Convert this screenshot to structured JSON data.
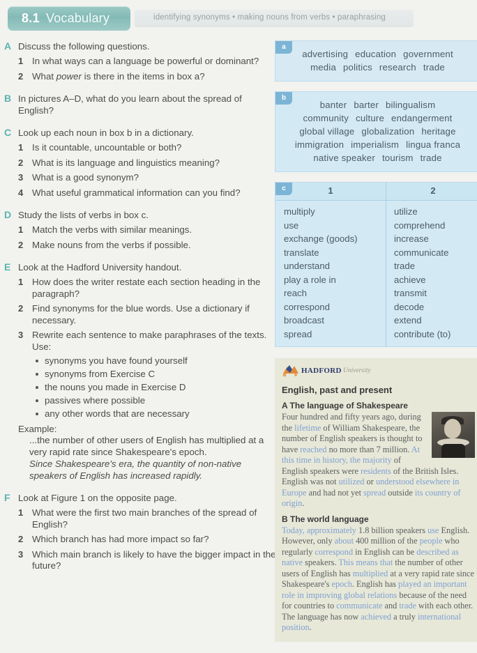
{
  "header": {
    "unit_number": "8.1",
    "unit_title": "Vocabulary",
    "skills": "identifying synonyms • making nouns from verbs • paraphrasing"
  },
  "exercises": [
    {
      "letter": "A",
      "heading": "Discuss the following questions.",
      "items": [
        {
          "num": "1",
          "text": "In what ways can a language be powerful or dominant?"
        },
        {
          "num": "2",
          "text": "What power is there in the items in box a?",
          "italic_word": "power"
        }
      ]
    },
    {
      "letter": "B",
      "heading": "In pictures A–D, what do you learn about the spread of English?",
      "items": []
    },
    {
      "letter": "C",
      "heading": "Look up each noun in box b in a dictionary.",
      "items": [
        {
          "num": "1",
          "text": "Is it countable, uncountable or both?"
        },
        {
          "num": "2",
          "text": "What is its language and linguistics meaning?"
        },
        {
          "num": "3",
          "text": "What is a good synonym?"
        },
        {
          "num": "4",
          "text": "What useful grammatical information can you find?"
        }
      ]
    },
    {
      "letter": "D",
      "heading": "Study the lists of verbs in box c.",
      "items": [
        {
          "num": "1",
          "text": "Match the verbs with similar meanings."
        },
        {
          "num": "2",
          "text": "Make nouns from the verbs if possible."
        }
      ]
    },
    {
      "letter": "E",
      "heading": "Look at the Hadford University handout.",
      "items": [
        {
          "num": "1",
          "text": "How does the writer restate each section heading in the paragraph?"
        },
        {
          "num": "2",
          "text": "Find synonyms for the blue words. Use a dictionary if necessary."
        },
        {
          "num": "3",
          "text": "Rewrite each sentence to make paraphrases of the texts. Use:"
        }
      ],
      "bullets": [
        "synonyms you have found yourself",
        "synonyms from Exercise C",
        "the nouns you made in Exercise D",
        "passives where possible",
        "any other words that are necessary"
      ],
      "example_label": "Example:",
      "example_plain": "...the number of other users of English has multiplied at a very rapid rate since Shakespeare's epoch.",
      "example_italic": "Since Shakespeare's era, the quantity of non-native speakers of English has increased rapidly."
    },
    {
      "letter": "F",
      "heading": "Look at Figure 1 on the opposite page.",
      "items": [
        {
          "num": "1",
          "text": "What were the first two main branches of the spread of English?"
        },
        {
          "num": "2",
          "text": "Which branch has had more impact so far?"
        },
        {
          "num": "3",
          "text": "Which main branch is likely to have the bigger impact in the future?"
        }
      ]
    }
  ],
  "box_a": {
    "label": "a",
    "lines": [
      [
        "advertising",
        "education",
        "government"
      ],
      [
        "media",
        "politics",
        "research",
        "trade"
      ]
    ]
  },
  "box_b": {
    "label": "b",
    "lines": [
      [
        "banter",
        "barter",
        "bilingualism"
      ],
      [
        "community",
        "culture",
        "endangerment"
      ],
      [
        "global village",
        "globalization",
        "heritage"
      ],
      [
        "immigration",
        "imperialism",
        "lingua franca"
      ],
      [
        "native speaker",
        "tourism",
        "trade"
      ]
    ]
  },
  "box_c": {
    "label": "c",
    "columns": [
      "1",
      "2"
    ],
    "column1": [
      "multiply",
      "use",
      "exchange (goods)",
      "translate",
      "understand",
      "play a role in",
      "reach",
      "correspond",
      "broadcast",
      "spread"
    ],
    "column2": [
      "utilize",
      "comprehend",
      "increase",
      "communicate",
      "trade",
      "achieve",
      "transmit",
      "decode",
      "extend",
      "contribute (to)"
    ]
  },
  "handout": {
    "logo_name": "HADFORD",
    "logo_sub": "University",
    "title": "English, past and present",
    "section_a": {
      "heading": "A The language of Shakespeare",
      "parts": [
        {
          "t": "Four hundred and fifty years ago, during the ",
          "hl": false
        },
        {
          "t": "lifetime",
          "hl": true
        },
        {
          "t": " of William Shakespeare, the number of English speakers is thought to have ",
          "hl": false
        },
        {
          "t": "reached",
          "hl": true
        },
        {
          "t": " no more than 7 million. ",
          "hl": false
        },
        {
          "t": "At this time in history, the majority",
          "hl": true
        },
        {
          "t": " of English speakers were ",
          "hl": false
        },
        {
          "t": "residents",
          "hl": true
        },
        {
          "t": " of the British Isles. English was not ",
          "hl": false
        },
        {
          "t": "utilized",
          "hl": true
        },
        {
          "t": " or ",
          "hl": false
        },
        {
          "t": "understood elsewhere in Europe",
          "hl": true
        },
        {
          "t": " and had not yet ",
          "hl": false
        },
        {
          "t": "spread",
          "hl": true
        },
        {
          "t": " outside ",
          "hl": false
        },
        {
          "t": "its country of origin",
          "hl": true
        },
        {
          "t": ".",
          "hl": false
        }
      ]
    },
    "section_b": {
      "heading": "B  The world language",
      "parts": [
        {
          "t": "Today, ",
          "hl": true
        },
        {
          "t": "approximately",
          "hl": true
        },
        {
          "t": " 1.8 billion speakers ",
          "hl": false
        },
        {
          "t": "use",
          "hl": true
        },
        {
          "t": " English. However, only ",
          "hl": false
        },
        {
          "t": "about",
          "hl": true
        },
        {
          "t": " 400 million of the ",
          "hl": false
        },
        {
          "t": "people",
          "hl": true
        },
        {
          "t": " who regularly ",
          "hl": false
        },
        {
          "t": "correspond",
          "hl": true
        },
        {
          "t": " in English can be ",
          "hl": false
        },
        {
          "t": "described as native",
          "hl": true
        },
        {
          "t": " speakers. ",
          "hl": false
        },
        {
          "t": "This means that",
          "hl": true
        },
        {
          "t": " the number of other users of English has ",
          "hl": false
        },
        {
          "t": "multiplied",
          "hl": true
        },
        {
          "t": " at a very rapid rate since Shakespeare's ",
          "hl": false
        },
        {
          "t": "epoch",
          "hl": true
        },
        {
          "t": ". English has ",
          "hl": false
        },
        {
          "t": "played an important role in improving global relations",
          "hl": true
        },
        {
          "t": " because of the need for countries to ",
          "hl": false
        },
        {
          "t": "communicate",
          "hl": true
        },
        {
          "t": " and ",
          "hl": false
        },
        {
          "t": "trade",
          "hl": true
        },
        {
          "t": " with each other. The language has now ",
          "hl": false
        },
        {
          "t": "achieved",
          "hl": true
        },
        {
          "t": " a truly ",
          "hl": false
        },
        {
          "t": "international position",
          "hl": true
        },
        {
          "t": ".",
          "hl": false
        }
      ]
    }
  },
  "colors": {
    "unit_tab": "#84bab6",
    "exercise_letter": "#5bb3ae",
    "word_box": "#d3e9f4",
    "box_tab": "#7cb4d6",
    "handout_bg": "#e7e8d8",
    "highlight_blue": "#7e9fd1"
  }
}
